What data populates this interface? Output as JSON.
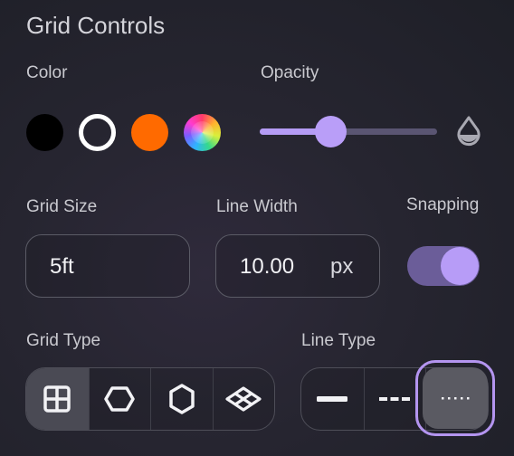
{
  "title": "Grid Controls",
  "color": {
    "label": "Color",
    "swatches": [
      {
        "name": "black",
        "hex": "#000000"
      },
      {
        "name": "white",
        "hex": "#ffffff"
      },
      {
        "name": "orange",
        "hex": "#ff6a00"
      },
      {
        "name": "custom-gradient",
        "hex": "multicolor"
      }
    ],
    "selected": "white"
  },
  "opacity": {
    "label": "Opacity",
    "value_fraction": 0.4,
    "icon": "opacity-drop-icon"
  },
  "grid_size": {
    "label": "Grid Size",
    "value": "5ft"
  },
  "line_width": {
    "label": "Line Width",
    "value": "10.00",
    "unit": "px"
  },
  "snapping": {
    "label": "Snapping",
    "enabled": true
  },
  "grid_type": {
    "label": "Grid Type",
    "options": [
      "square-grid-icon",
      "hex-horizontal-icon",
      "hex-vertical-icon",
      "isometric-grid-icon"
    ],
    "selected": "square-grid-icon"
  },
  "line_type": {
    "label": "Line Type",
    "options": [
      "solid-line-icon",
      "dashed-line-icon",
      "dotted-line-icon"
    ],
    "selected": "dotted-line-icon"
  },
  "colors": {
    "accent": "#b99ef8",
    "toggle_track": "#6b5d99",
    "background": "#262530"
  }
}
